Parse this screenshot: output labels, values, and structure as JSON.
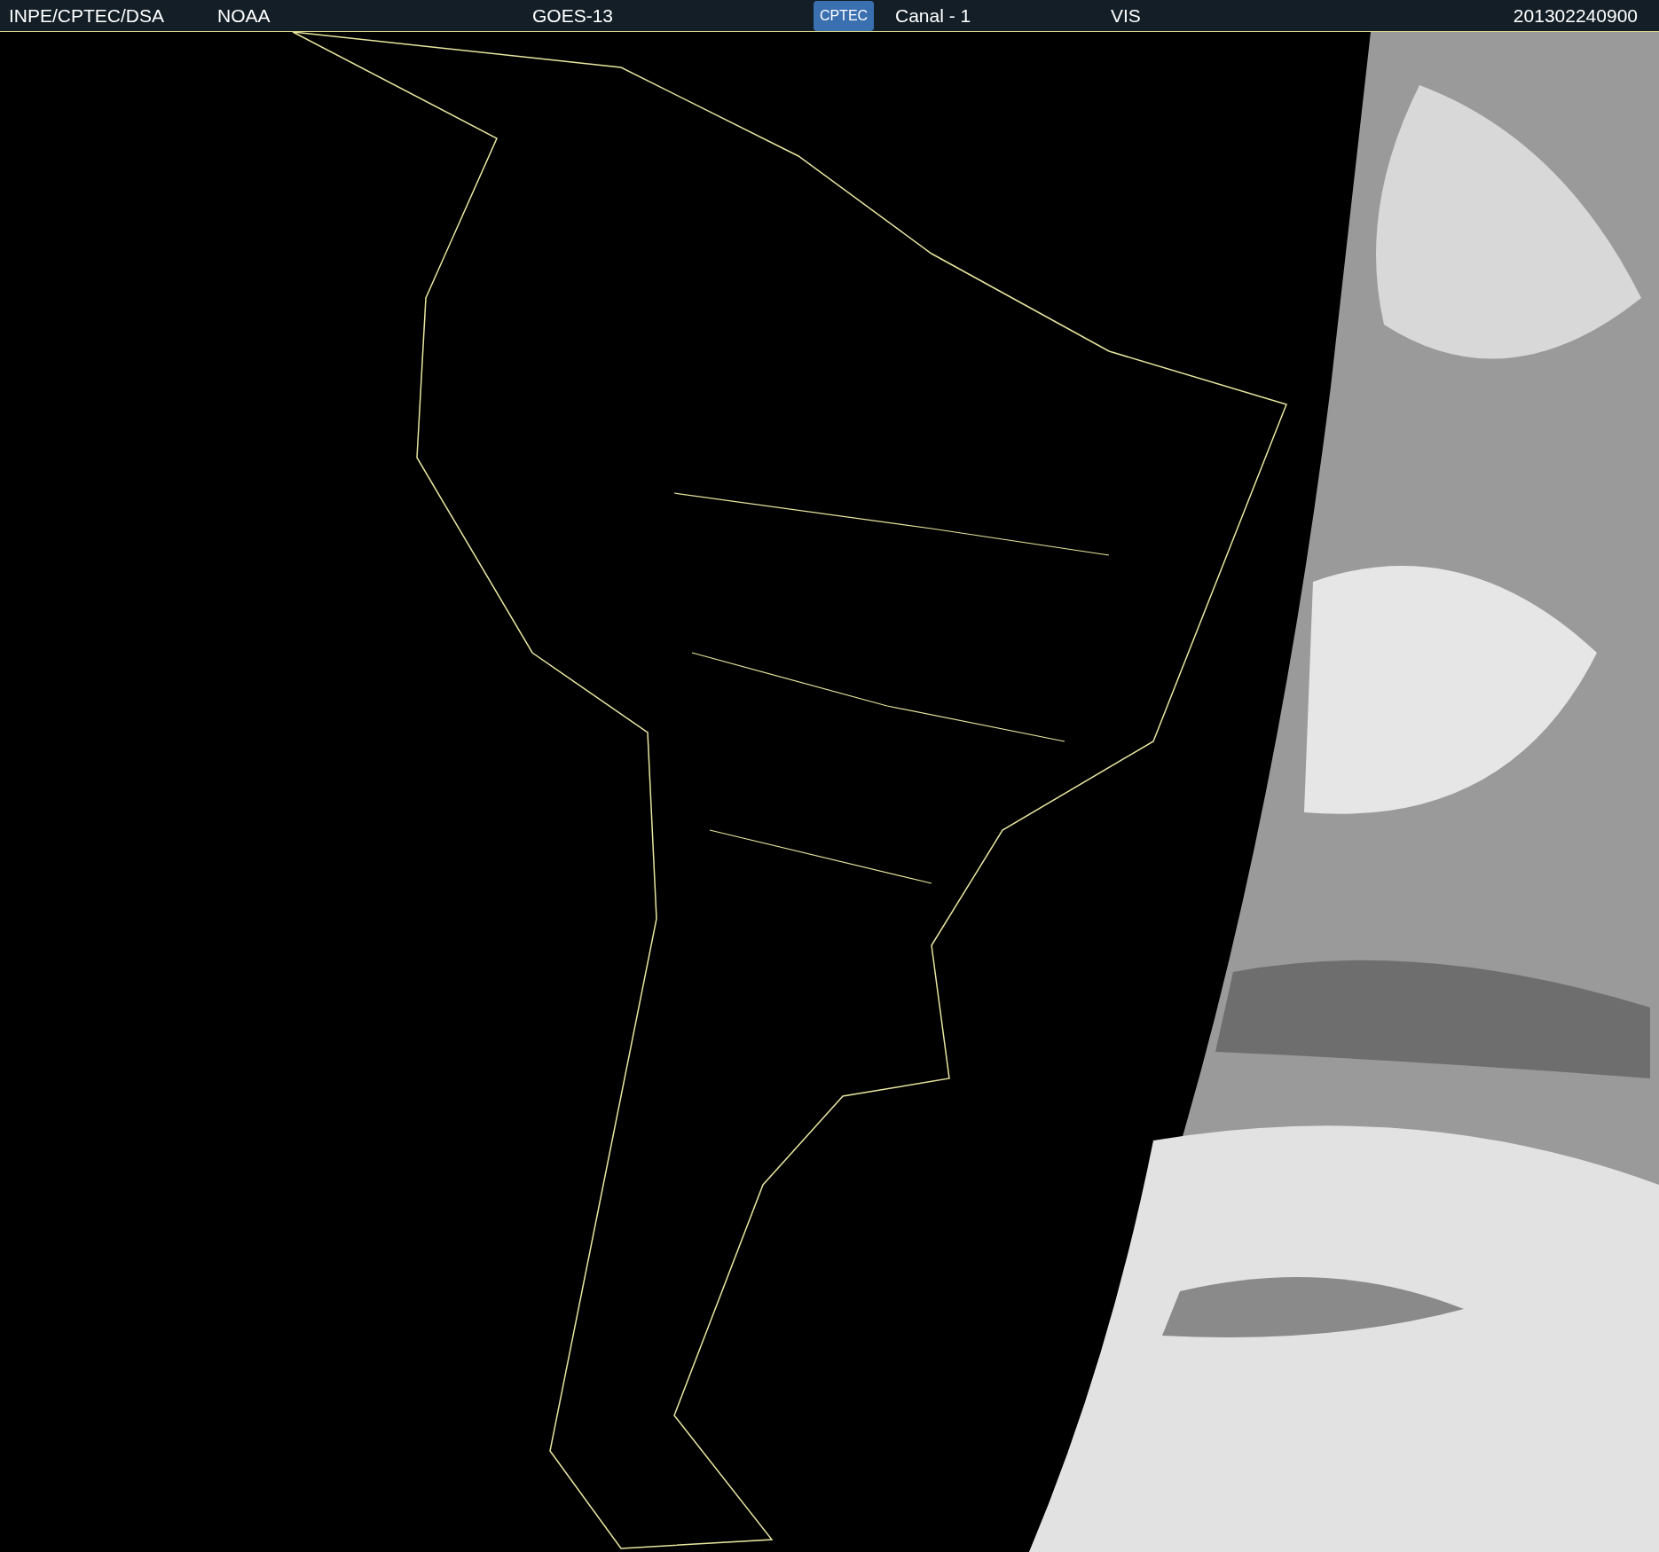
{
  "header": {
    "source": "INPE/CPTEC/DSA",
    "agency": "NOAA",
    "satellite": "GOES-13",
    "logo": "CPTEC",
    "channel": "Canal - 1",
    "band": "VIS",
    "timestamp": "201302240900"
  }
}
